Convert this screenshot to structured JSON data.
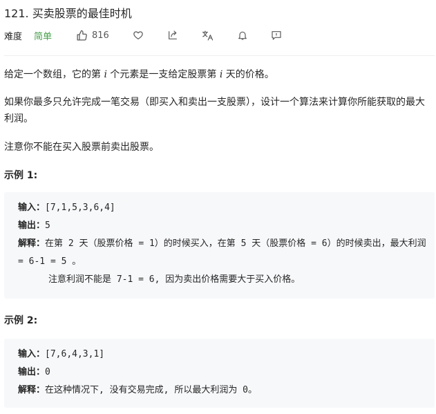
{
  "title": "121. 买卖股票的最佳时机",
  "meta": {
    "difficulty_label": "难度",
    "difficulty_value": "简单",
    "likes": "816",
    "icons": [
      "thumb-up-icon",
      "heart-icon",
      "share-icon",
      "translate-icon",
      "bell-icon",
      "feedback-icon"
    ],
    "easy_color": "#43a047"
  },
  "description": {
    "p1_a": "给定一个数组，它的第 ",
    "p1_i1": "i",
    "p1_b": " 个元素是一支给定股票第 ",
    "p1_i2": "i",
    "p1_c": " 天的价格。",
    "p2": "如果你最多只允许完成一笔交易（即买入和卖出一支股票），设计一个算法来计算你所能获取的最大利润。",
    "p3": "注意你不能在买入股票前卖出股票。"
  },
  "examples": [
    {
      "title": "示例 1:",
      "input_label": "输入：",
      "input": "[7,1,5,3,6,4]",
      "output_label": "输出：",
      "output": "5",
      "explain_label": "解释：",
      "explain": "在第 2 天（股票价格 = 1）的时候买入，在第 5 天（股票价格 = 6）的时候卖出，最大利润 = 6-1 = 5 。",
      "note": "注意利润不能是 7-1 = 6, 因为卖出价格需要大于买入价格。"
    },
    {
      "title": "示例 2:",
      "input_label": "输入：",
      "input": "[7,6,4,3,1]",
      "output_label": "输出：",
      "output": "0",
      "explain_label": "解释：",
      "explain": "在这种情况下, 没有交易完成, 所以最大利润为 0。"
    }
  ]
}
